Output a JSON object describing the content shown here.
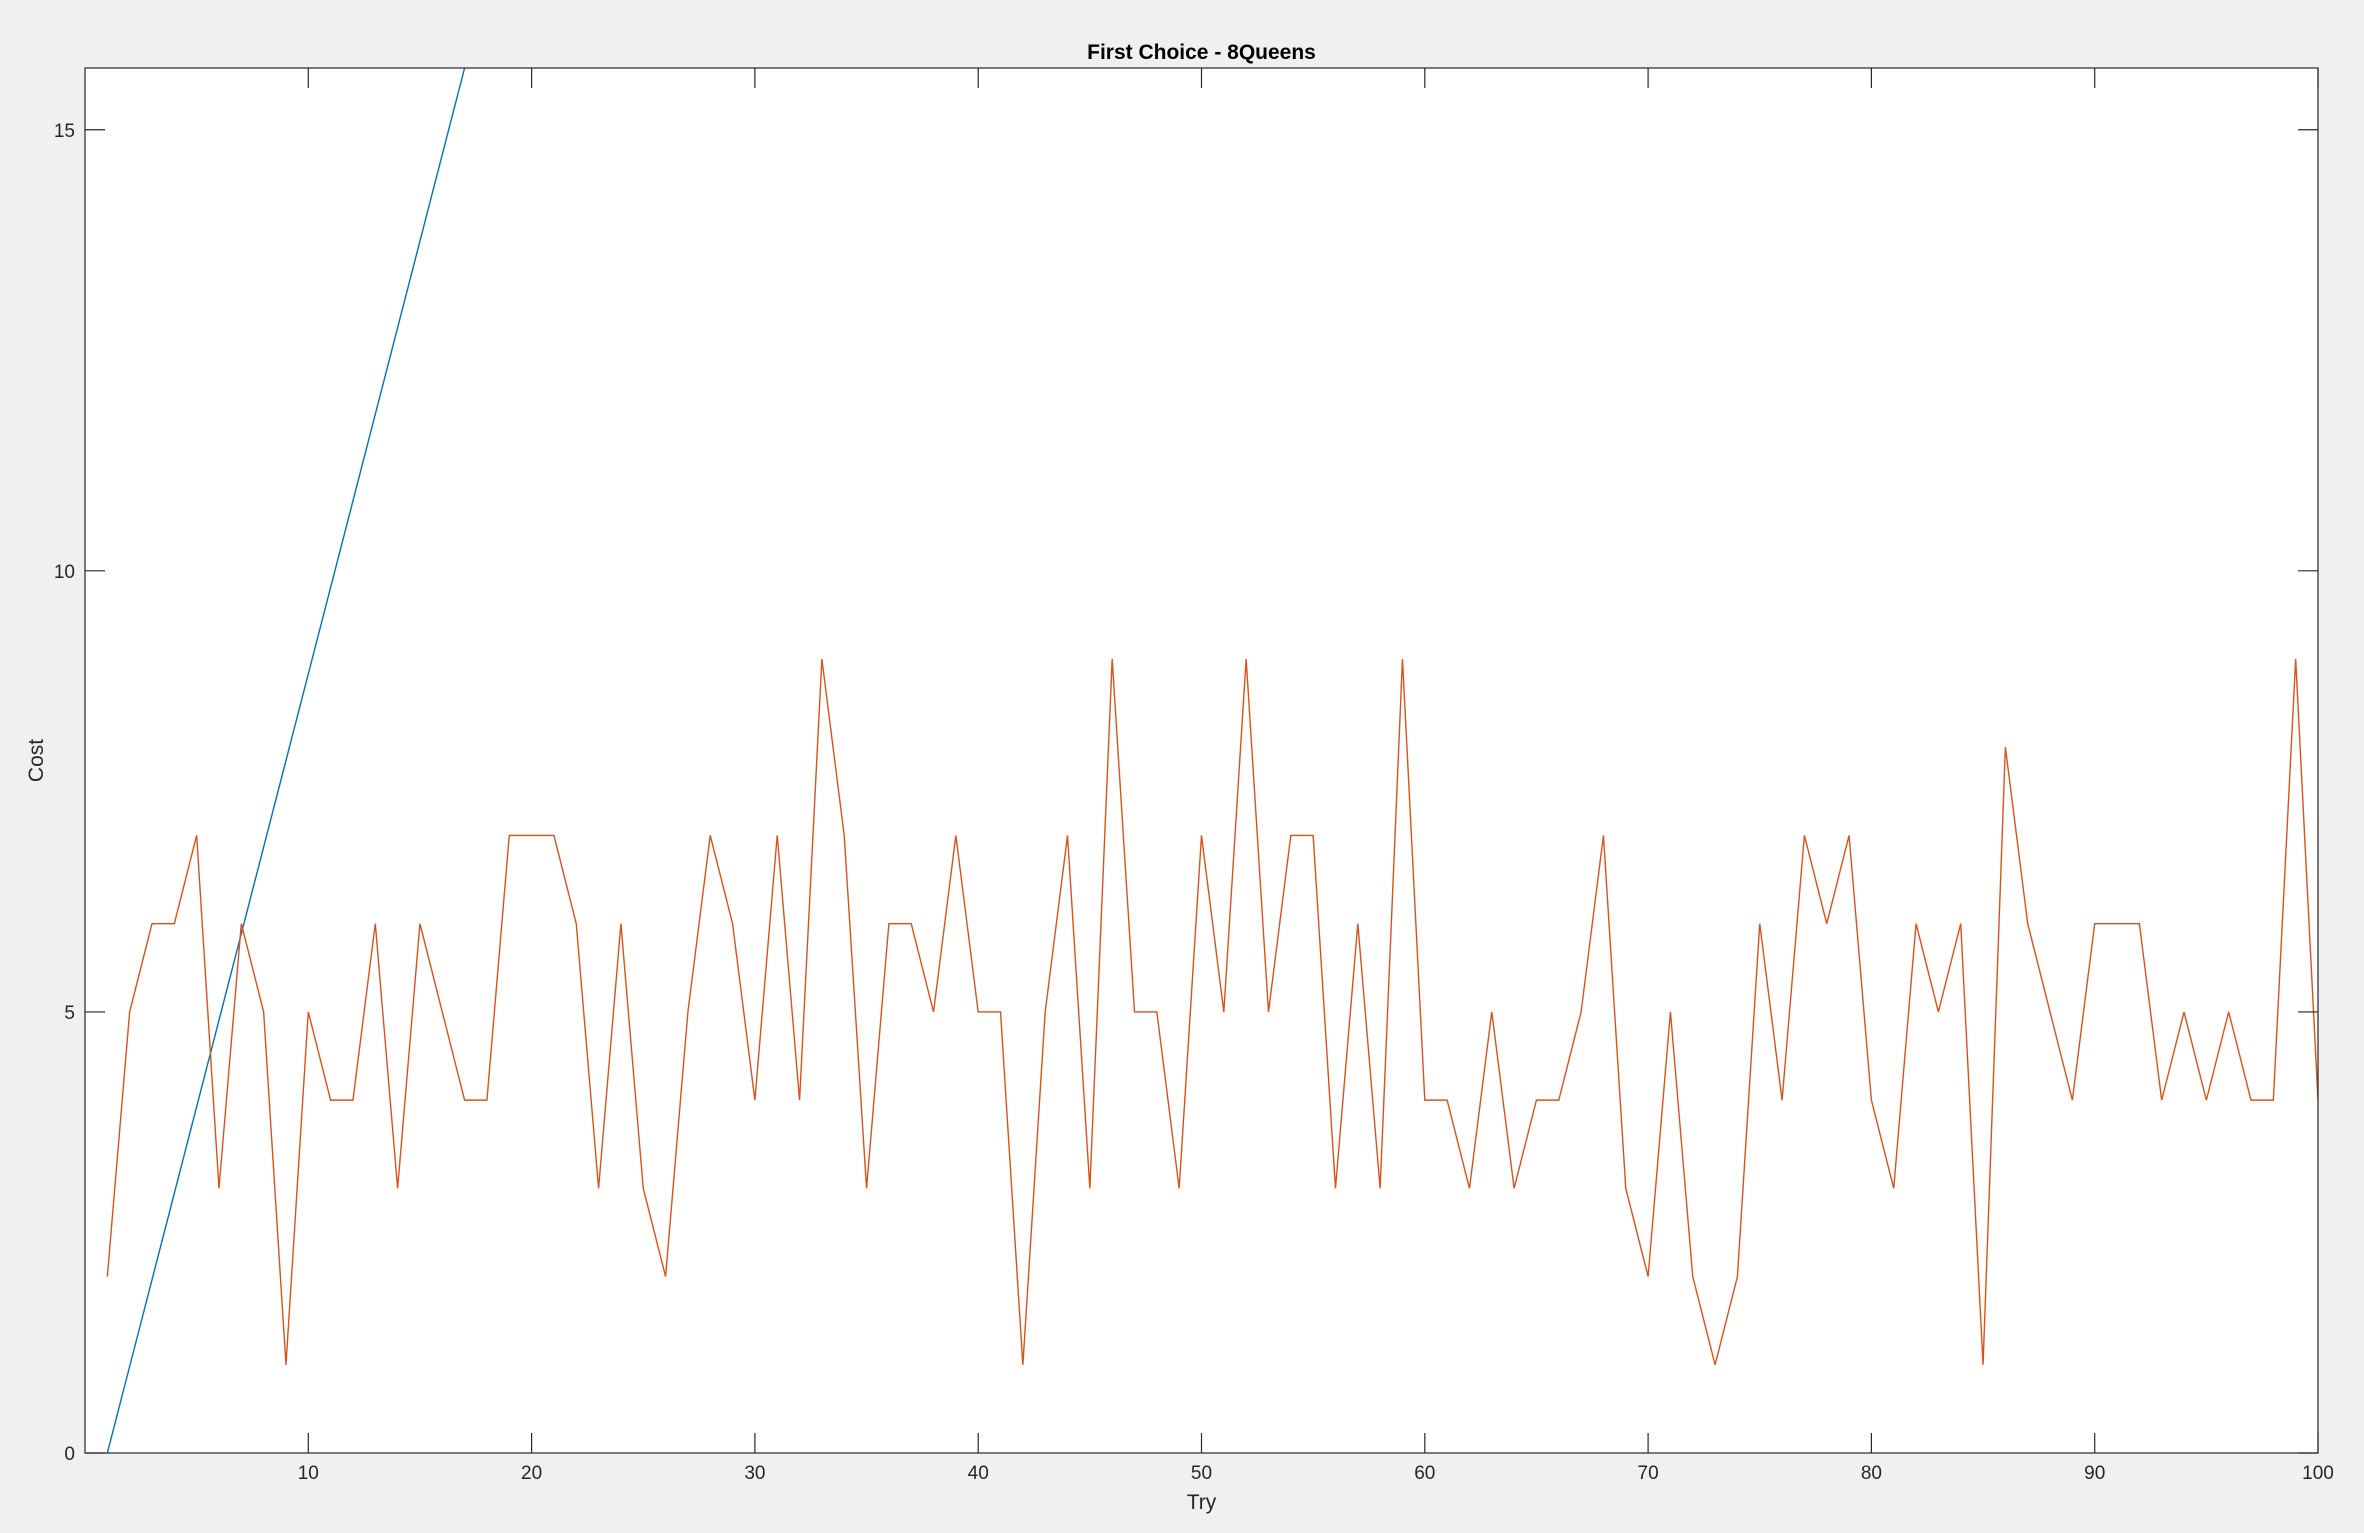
{
  "chart_data": {
    "type": "line",
    "title": "First Choice - 8Queens",
    "xlabel": "Try",
    "ylabel": "Cost",
    "xlim": [
      0,
      100
    ],
    "ylim": [
      0,
      15.7
    ],
    "xticks": [
      10,
      20,
      30,
      40,
      50,
      60,
      70,
      80,
      90,
      100
    ],
    "yticks": [
      0,
      5,
      10,
      15
    ],
    "grid": false,
    "series": [
      {
        "color": "#0072bd",
        "x": [
          1,
          17
        ],
        "y": [
          0,
          15.7
        ]
      },
      {
        "color": "#d95319",
        "x": [
          1,
          2,
          3,
          4,
          5,
          6,
          7,
          8,
          9,
          10,
          11,
          12,
          13,
          14,
          15,
          16,
          17,
          18,
          19,
          20,
          21,
          22,
          23,
          24,
          25,
          26,
          27,
          28,
          29,
          30,
          31,
          32,
          33,
          34,
          35,
          36,
          37,
          38,
          39,
          40,
          41,
          42,
          43,
          44,
          45,
          46,
          47,
          48,
          49,
          50,
          51,
          52,
          53,
          54,
          55,
          56,
          57,
          58,
          59,
          60,
          61,
          62,
          63,
          64,
          65,
          66,
          67,
          68,
          69,
          70,
          71,
          72,
          73,
          74,
          75,
          76,
          77,
          78,
          79,
          80,
          81,
          82,
          83,
          84,
          85,
          86,
          87,
          88,
          89,
          90,
          91,
          92,
          93,
          94,
          95,
          96,
          97,
          98,
          99,
          100
        ],
        "y": [
          2,
          5,
          6,
          6,
          7,
          3,
          6,
          5,
          1,
          5,
          4,
          4,
          6,
          3,
          6,
          5,
          4,
          4,
          7,
          7,
          7,
          6,
          3,
          6,
          3,
          2,
          5,
          7,
          6,
          4,
          7,
          4,
          9,
          7,
          3,
          6,
          6,
          5,
          7,
          5,
          5,
          1,
          5,
          7,
          3,
          9,
          5,
          5,
          3,
          7,
          5,
          9,
          5,
          7,
          7,
          3,
          6,
          3,
          9,
          4,
          4,
          3,
          5,
          3,
          4,
          4,
          5,
          7,
          3,
          2,
          5,
          2,
          1,
          2,
          6,
          4,
          7,
          6,
          7,
          4,
          3,
          6,
          5,
          6,
          1,
          8,
          6,
          5,
          4,
          6,
          6,
          6,
          4,
          5,
          4,
          5,
          4,
          4,
          9,
          4
        ]
      }
    ]
  }
}
